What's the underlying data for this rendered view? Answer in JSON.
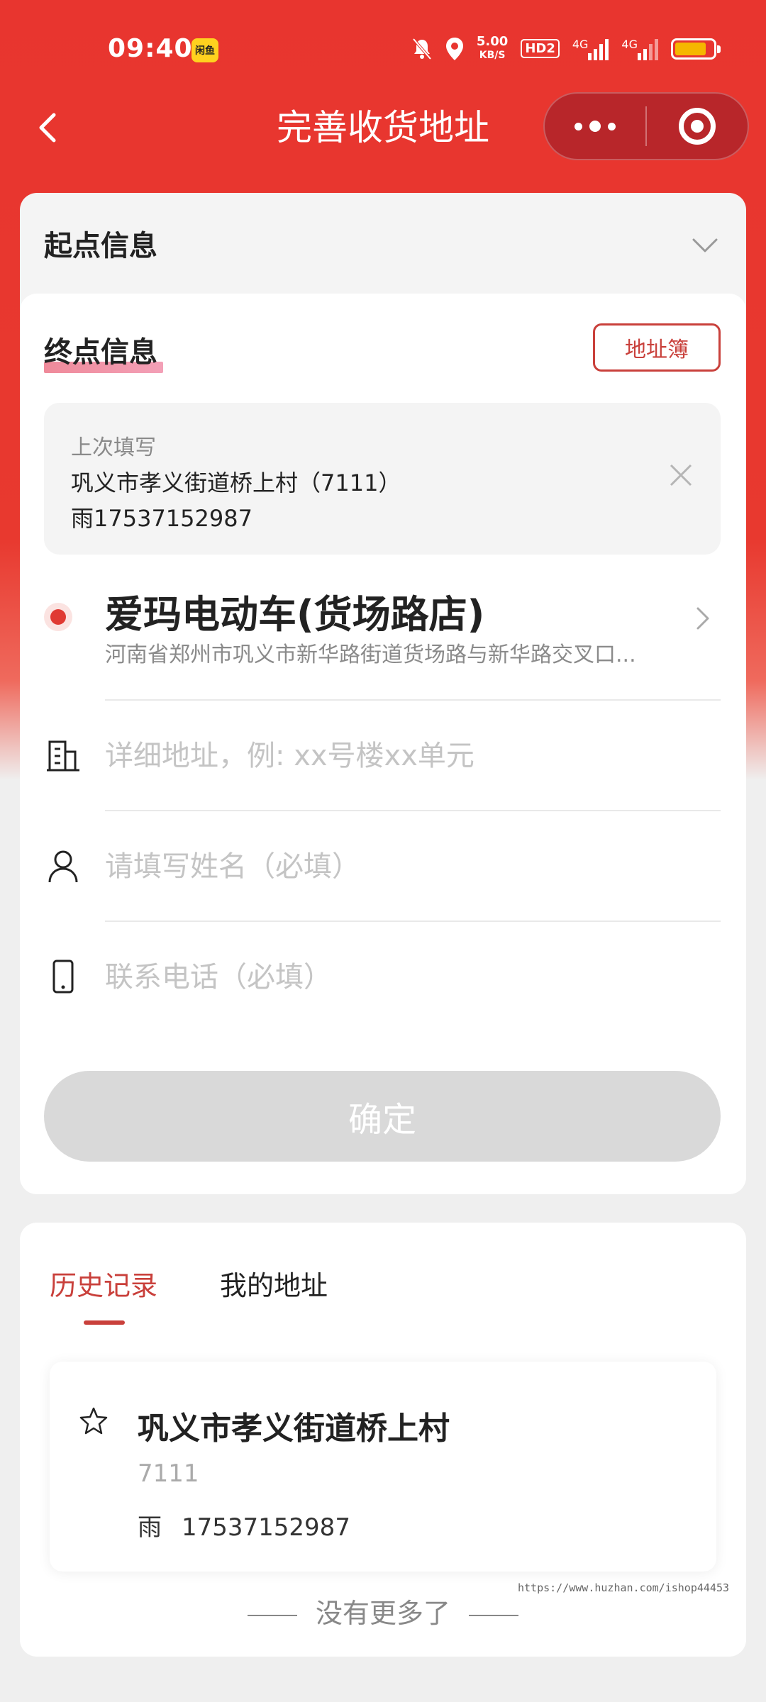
{
  "status_bar": {
    "time": "09:40",
    "app_badge": "闲鱼",
    "speed_value": "5.00",
    "speed_unit": "KB/S",
    "hd_label": "HD2",
    "signal1_label": "4G",
    "signal2_label": "4G",
    "accent_color": "#e8352f"
  },
  "nav": {
    "title": "完善收货地址",
    "back_icon": "chevron-left-icon",
    "more_icon": "more-dots-icon",
    "close_icon": "target-circle-icon"
  },
  "start_section": {
    "title": "起点信息"
  },
  "end_section": {
    "title": "终点信息",
    "address_book_label": "地址簿",
    "last_filled": {
      "label": "上次填写",
      "address": "巩义市孝义街道桥上村（7111）",
      "contact": "雨17537152987"
    },
    "destination": {
      "name": "爱玛电动车(货场路店)",
      "address": "河南省郑州市巩义市新华路街道货场路与新华路交叉口..."
    },
    "fields": {
      "detail_placeholder": "详细地址，例: xx号楼xx单元",
      "name_placeholder": "请填写姓名（必填）",
      "phone_placeholder": "联系电话（必填）"
    },
    "confirm_label": "确定",
    "button_disabled_color": "#d9d9d9"
  },
  "history": {
    "tabs": [
      {
        "label": "历史记录",
        "active": true
      },
      {
        "label": "我的地址",
        "active": false
      }
    ],
    "records": [
      {
        "title": "巩义市孝义街道桥上村",
        "number": "7111",
        "name": "雨",
        "phone": "17537152987"
      }
    ],
    "no_more_text": "没有更多了"
  },
  "watermark": "https://www.huzhan.com/ishop44453"
}
